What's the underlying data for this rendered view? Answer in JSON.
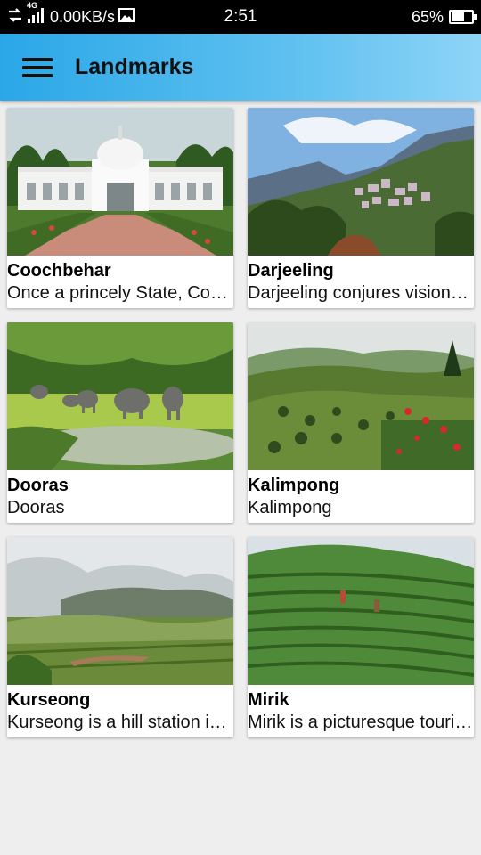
{
  "status_bar": {
    "network_speed": "0.00KB/s",
    "network_type": "4G",
    "time": "2:51",
    "battery_percent": "65%",
    "battery_level": 0.65,
    "icons": [
      "data-transfer-icon",
      "signal-icon",
      "image-notification-icon",
      "battery-icon"
    ]
  },
  "app_bar": {
    "title": "Landmarks",
    "menu_icon": "hamburger-menu-icon",
    "gradient_start": "#2aa7e7",
    "gradient_end": "#8ed4f7"
  },
  "landmarks": [
    {
      "title": "Coochbehar",
      "description": "Once a princely State, Coochbehar..."
    },
    {
      "title": "Darjeeling",
      "description": "Darjeeling conjures visions of..."
    },
    {
      "title": "Dooras",
      "description": "Dooras"
    },
    {
      "title": "Kalimpong",
      "description": "Kalimpong"
    },
    {
      "title": "Kurseong",
      "description": "Kurseong is a hill station in..."
    },
    {
      "title": "Mirik",
      "description": "Mirik is a picturesque tourist..."
    }
  ]
}
